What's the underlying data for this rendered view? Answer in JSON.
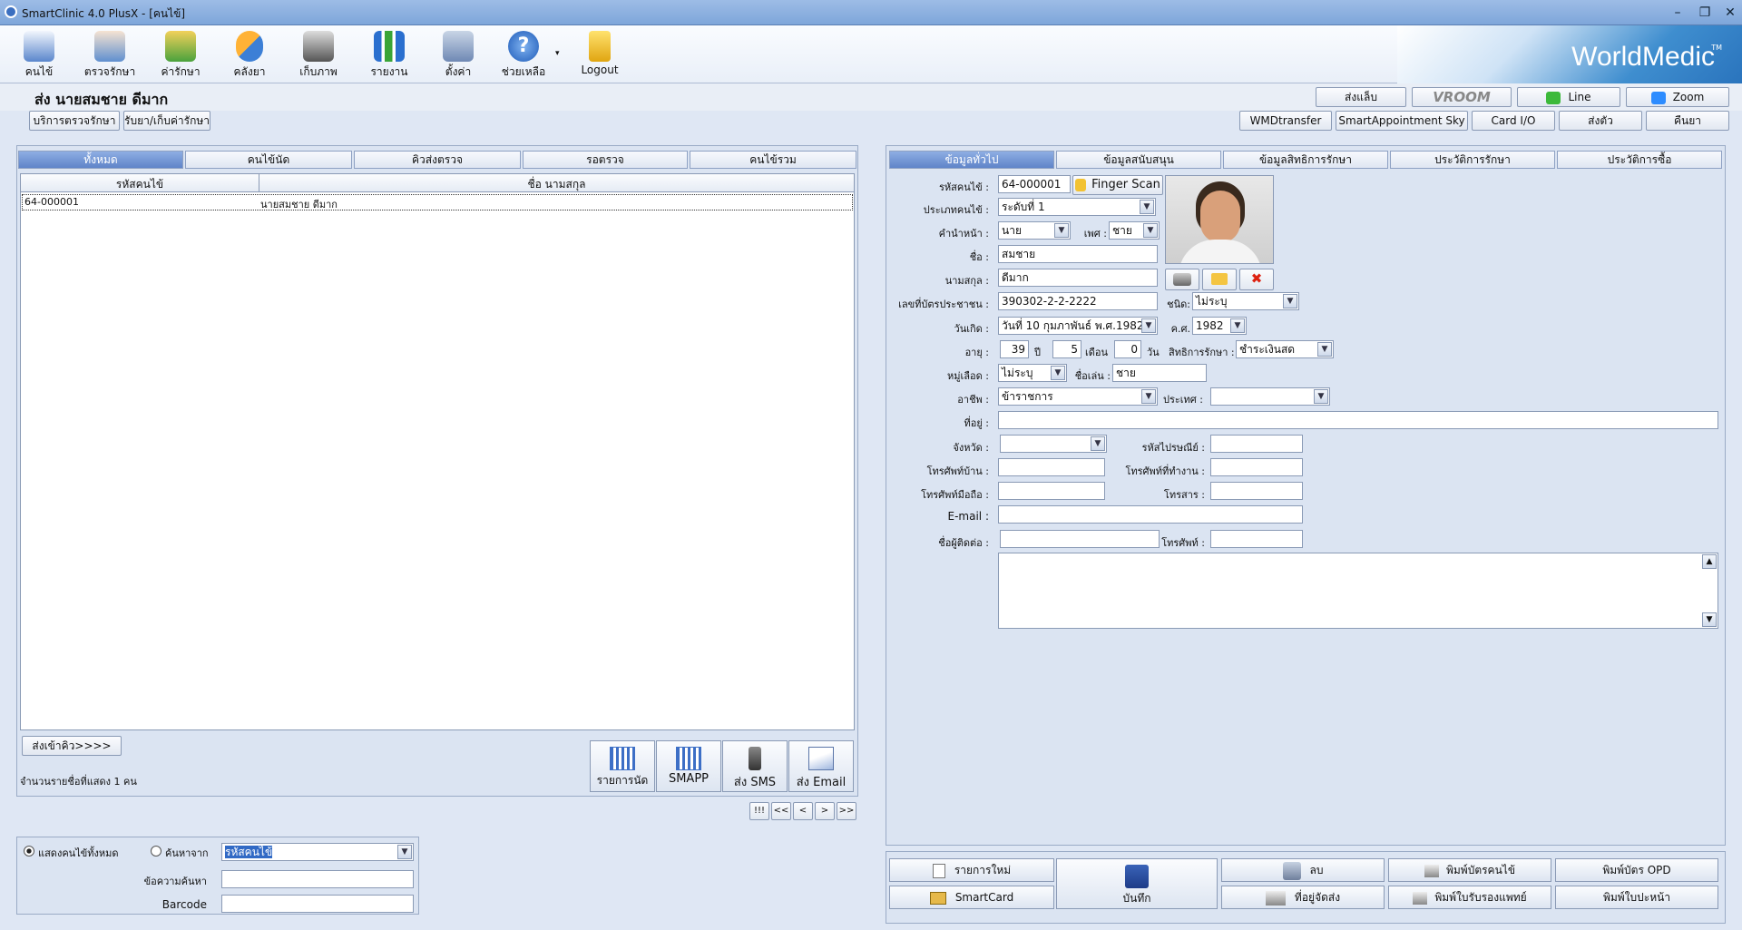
{
  "window": {
    "title": "SmartClinic 4.0 PlusX - [คนไข้]"
  },
  "toolbar": {
    "items": [
      {
        "label": "คนไข้",
        "icon": "patient-card-icon"
      },
      {
        "label": "ตรวจรักษา",
        "icon": "doctor-icon"
      },
      {
        "label": "ค่ารักษา",
        "icon": "money-icon"
      },
      {
        "label": "คลังยา",
        "icon": "pill-icon"
      },
      {
        "label": "เก็บภาพ",
        "icon": "camera-icon"
      },
      {
        "label": "รายงาน",
        "icon": "bar-chart-icon"
      },
      {
        "label": "ตั้งค่า",
        "icon": "tools-icon"
      },
      {
        "label": "ช่วยเหลือ",
        "icon": "help-icon"
      },
      {
        "label": "Logout",
        "icon": "lock-icon"
      }
    ]
  },
  "brand": {
    "name": "WorldMedic",
    "tm": "TM"
  },
  "header": {
    "title": "ส่ง  นายสมชาย ดีมาก",
    "top_buttons": [
      "ส่งแล็บ",
      "VROOM",
      "Line",
      "Zoom"
    ],
    "second_buttons": [
      "WMDtransfer",
      "SmartAppointment Sky",
      "Card I/O",
      "ส่งตัว",
      "คืนยา"
    ],
    "left_buttons": [
      "บริการตรวจรักษา",
      "รับยา/เก็บค่ารักษา"
    ]
  },
  "left": {
    "tabs": [
      "ทั้งหมด",
      "คนไข้นัด",
      "คิวส่งตรวจ",
      "รอตรวจ",
      "คนไข้รวม"
    ],
    "columns": [
      "รหัสคนไข้",
      "ชื่อ นามสกุล"
    ],
    "rows": [
      {
        "id": "64-000001",
        "name": "นายสมชาย ดีมาก"
      }
    ],
    "send_queue": "ส่งเข้าคิว>>>>",
    "count_text": "จำนวนรายชื่อที่แสดง 1 คน",
    "actions": [
      "รายการนัด",
      "SMAPP",
      "ส่ง SMS",
      "ส่ง Email"
    ],
    "pager": [
      "!!!",
      "<<",
      "<",
      ">",
      ">>"
    ],
    "search": {
      "show_all": "แสดงคนไข้ทั้งหมด",
      "search_from": "ค้นหาจาก",
      "field": "รหัสคนไข้",
      "text_label": "ข้อความค้นหา",
      "barcode_label": "Barcode"
    }
  },
  "right": {
    "tabs": [
      "ข้อมูลทั่วไป",
      "ข้อมูลสนับสนุน",
      "ข้อมูลสิทธิการรักษา",
      "ประวัติการรักษา",
      "ประวัติการซื้อ"
    ],
    "labels": {
      "hn": "รหัสคนไข้ :",
      "ptype": "ประเภทคนไข้ :",
      "prefix": "คำนำหน้า :",
      "sex": "เพศ :",
      "fname": "ชื่อ :",
      "lname": "นามสกุล :",
      "idcard": "เลขที่บัตรประชาชน :",
      "idtype": "ชนิด:",
      "dob": "วันเกิด :",
      "ad": "ค.ศ.",
      "age": "อายุ :",
      "years": "ปี",
      "months": "เดือน",
      "days": "วัน",
      "right": "สิทธิการรักษา :",
      "blood": "หมู่เลือด :",
      "nick": "ชื่อเล่น :",
      "job": "อาชีพ :",
      "country": "ประเทศ :",
      "address": "ที่อยู่ :",
      "province": "จังหวัด :",
      "zip": "รหัสไปรษณีย์ :",
      "homephone": "โทรศัพท์บ้าน :",
      "workphone": "โทรศัพท์ที่ทำงาน :",
      "mobile": "โทรศัพท์มือถือ :",
      "fax": "โทรสาร :",
      "email": "E-mail :",
      "contact": "ชื่อผู้ติดต่อ :",
      "cphone": "โทรศัพท์ :"
    },
    "values": {
      "hn": "64-000001",
      "finger": "Finger Scan",
      "ptype": "ระดับที่ 1",
      "prefix": "นาย",
      "sex": "ชาย",
      "fname": "สมชาย",
      "lname": "ดีมาก",
      "idcard": "390302-2-2-2222",
      "idtype": "ไม่ระบุ",
      "dob": "วันที่ 10 กุมภาพันธ์ พ.ศ.1982",
      "ad": "1982",
      "age_y": "39",
      "age_m": "5",
      "age_d": "0",
      "right": "ชำระเงินสด",
      "blood": "ไม่ระบุ",
      "nick": "ชาย",
      "job": "ข้าราชการ"
    },
    "footer": {
      "new": "รายการใหม่",
      "save": "บันทึก",
      "delete": "ลบ",
      "print_card": "พิมพ์บัตรคนไข้",
      "print_opd": "พิมพ์บัตร OPD",
      "smartcard": "SmartCard",
      "ship": "ที่อยู่จัดส่ง",
      "print_cert": "พิมพ์ใบรับรองแพทย์",
      "print_front": "พิมพ์ใบปะหน้า"
    }
  }
}
